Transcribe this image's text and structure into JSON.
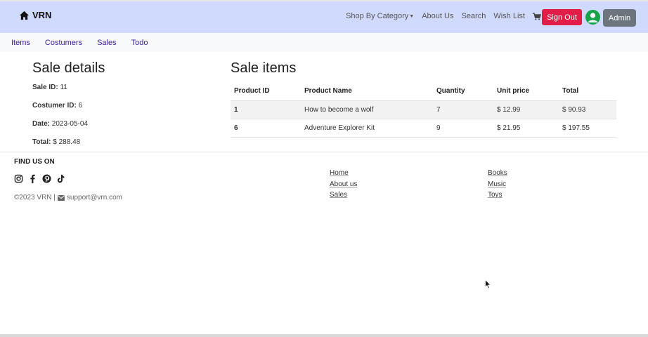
{
  "navbar": {
    "brand": "VRN",
    "links": {
      "category": "Shop By Category",
      "about": "About Us",
      "search": "Search",
      "wishlist": "Wish List",
      "cart_count": "- 0"
    },
    "sign_out": "Sign Out",
    "admin": "Admin",
    "colors": {
      "background": "#cfdafc",
      "sign_out": "#e11d48",
      "admin": "#6c757d",
      "avatar": "#17a34a"
    }
  },
  "subnav": {
    "items": [
      "Items",
      "Costumers",
      "Sales",
      "Todo"
    ]
  },
  "sale_details": {
    "title": "Sale details",
    "rows": [
      {
        "label": "Sale ID:",
        "value": "11"
      },
      {
        "label": "Costumer ID:",
        "value": "6"
      },
      {
        "label": "Date:",
        "value": "2023-05-04"
      },
      {
        "label": "Total:",
        "value": "$ 288.48"
      }
    ]
  },
  "sale_items": {
    "title": "Sale items",
    "columns": [
      "Product ID",
      "Product Name",
      "Quantity",
      "Unit price",
      "Total"
    ],
    "rows": [
      [
        "1",
        "How to become a wolf",
        "7",
        "$ 12.99",
        "$ 90.93"
      ],
      [
        "6",
        "Adventure Explorer Kit",
        "9",
        "$ 21.95",
        "$ 197.55"
      ]
    ]
  },
  "footer": {
    "heading": "FIND US ON",
    "social": [
      "instagram-icon",
      "facebook-icon",
      "pinterest-icon",
      "tiktok-icon"
    ],
    "copyright": "©2023 VRN |",
    "email": "support@vrn.com",
    "links_col1": [
      "Home",
      "About us",
      "Sales"
    ],
    "links_col2": [
      "Books",
      "Music",
      "Toys"
    ]
  }
}
